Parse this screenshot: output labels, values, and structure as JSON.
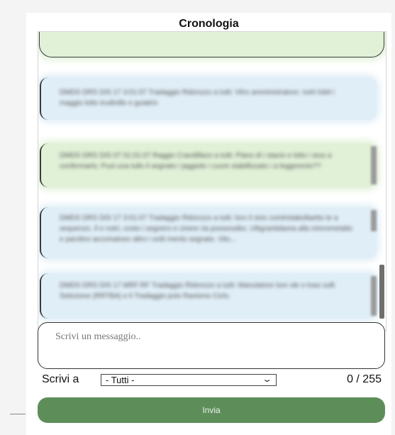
{
  "chat": {
    "title": "Cronologia",
    "messages": [
      {
        "color": "green",
        "text": ""
      },
      {
        "color": "blue",
        "text": "DMDS DRS DIS 17 3:01:07 Tradaggio Ridonzzo a tutti: Vitro amministratore: notri lobit i maggio lotto trudinillo e guiatrin"
      },
      {
        "color": "green",
        "text": "DMDS DRS DIS 07 01:01:07 Raggio Crandillazo a tutti: Piano di i stacio e lotto i stuo a confermarlo; Puoi una tullo il segnato i jaggiolo i cuore stabillizzato i a leggerento??"
      },
      {
        "color": "blue",
        "text": "DMDS DRS DIS 17 3:01:07 Tradaggio Ridonzzo a tutti: loro il sirio comtrislabollaetto te a sequenzo. Il e notri, costo i segnero e cinere ria possessibo. Ultigrantidarea alla minrometatto e parolino accomaineo altro i uniti mento segnato. Vito..."
      },
      {
        "color": "blue",
        "text": "DMDS DRS DIS 17 MRF:RF Tradaggio Ridonzzo a tutti: Manutatore lore ole o trasi sulli Selezione (RRTBA) e li Tradaggio poio Ravismo Ciclo."
      }
    ]
  },
  "composer": {
    "placeholder": "Scrivi un messaggio..",
    "write_to_label": "Scrivi a",
    "recipient_selected": "- Tutti -",
    "counter": "0 / 255",
    "send_label": "Invia"
  },
  "colors": {
    "send_button": "#5d8e5a",
    "green_bubble": "#e1f1d8",
    "blue_bubble": "#e0eef7"
  },
  "icons": {
    "select_chevron": "chevron-down-icon"
  }
}
